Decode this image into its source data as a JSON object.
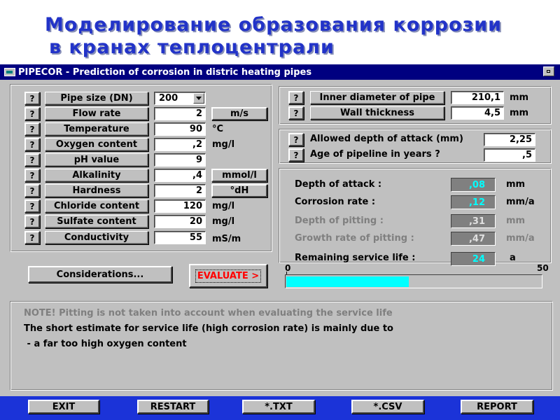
{
  "slide": {
    "title_line1": "Моделирование образования коррозии",
    "title_line2": "в кранах теплоцентрали"
  },
  "window": {
    "title": "PIPECOR - Prediction of corrosion in distric heating pipes"
  },
  "help_label": "?",
  "water": {
    "rows": [
      {
        "label": "Pipe size (DN)",
        "value": "200",
        "unit": ""
      },
      {
        "label": "Flow rate",
        "value": "2",
        "unit": "m/s"
      },
      {
        "label": "Temperature",
        "value": "90",
        "unit": "°C"
      },
      {
        "label": "Oxygen content",
        "value": ",2",
        "unit": "mg/l"
      },
      {
        "label": "pH value",
        "value": "9",
        "unit": ""
      },
      {
        "label": "Alkalinity",
        "value": ",4",
        "unit": "mmol/l"
      },
      {
        "label": "Hardness",
        "value": "2",
        "unit": "°dH"
      },
      {
        "label": "Chloride content",
        "value": "120",
        "unit": "mg/l"
      },
      {
        "label": "Sulfate content",
        "value": "20",
        "unit": "mg/l"
      },
      {
        "label": "Conductivity",
        "value": "55",
        "unit": "mS/m"
      }
    ]
  },
  "pipe": {
    "rows": [
      {
        "label": "Inner diameter of pipe",
        "value": "210,1",
        "unit": "mm"
      },
      {
        "label": "Wall thickness",
        "value": "4,5",
        "unit": "mm"
      }
    ]
  },
  "attack": {
    "rows": [
      {
        "label": "Allowed depth of attack (mm)",
        "value": "2,25"
      },
      {
        "label": "Age of pipeline in years ?",
        "value": ",5"
      }
    ]
  },
  "results": {
    "rows": [
      {
        "label": "Depth of attack :",
        "value": ",08",
        "unit": "mm"
      },
      {
        "label": "Corrosion rate :",
        "value": ",12",
        "unit": "mm/a"
      },
      {
        "label": "Depth of pitting :",
        "value": ",31",
        "unit": "mm"
      },
      {
        "label": "Growth rate of pitting :",
        "value": ",47",
        "unit": "mm/a"
      },
      {
        "label": "Remaining service life :",
        "value": "24",
        "unit": "a"
      }
    ],
    "scale_min": "0",
    "scale_max": "50",
    "life_fraction": 0.48
  },
  "buttons": {
    "considerations": "Considerations...",
    "evaluate": "EVALUATE >"
  },
  "note": {
    "line1": "NOTE!  Pitting is not taken into account when evaluating the service life",
    "line2": "The short estimate for service life (high corrosion rate) is mainly due to",
    "line3": " - a far too high oxygen content"
  },
  "bottom": {
    "exit": "EXIT",
    "restart": "RESTART",
    "txt": "*.TXT",
    "csv": "*.CSV",
    "report": "REPORT"
  },
  "colors": {
    "titlebar": "#000080",
    "window": "#c0c0c0",
    "bottom_bar": "#1b33d8",
    "progress": "#00ffff",
    "evaluate_text": "#ff0000",
    "slide_title": "#2233c8"
  }
}
